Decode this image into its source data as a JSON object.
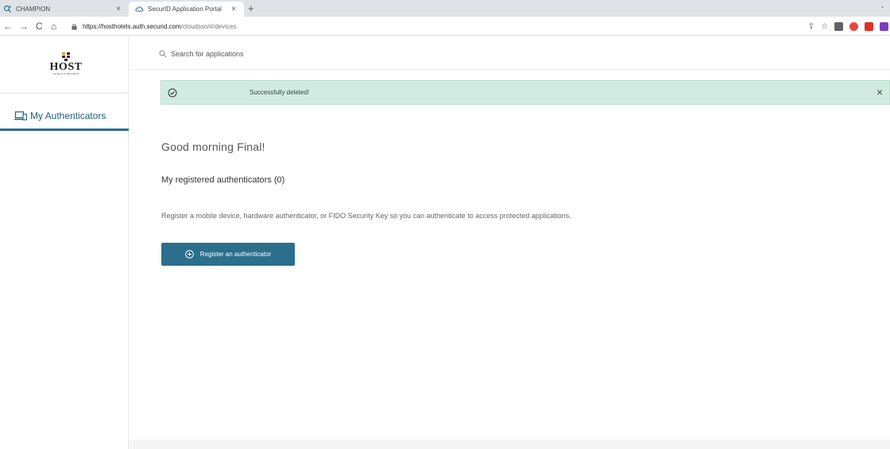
{
  "browser": {
    "tabs": [
      {
        "title": "CHAMPION",
        "close": "×",
        "icon": "search-favicon"
      },
      {
        "title": "SecurID Application Portal",
        "close": "×",
        "icon": "cloud-favicon"
      }
    ],
    "new_tab": "+",
    "url_host": "https://hosthotels.auth.securid.com",
    "url_path": "/cloudsso/#/devices",
    "nav": {
      "back": "←",
      "forward": "→",
      "reload": "C",
      "home": "⌂"
    }
  },
  "sidebar": {
    "logo_text": "HOST",
    "logo_sub": "HOTELS & RESORTS",
    "items": [
      {
        "label": "My Authenticators",
        "icon": "devices-icon"
      }
    ]
  },
  "search": {
    "placeholder": "Search for applications"
  },
  "alert": {
    "message": "Successfully deleted!",
    "close": "×",
    "status_color": "#d2ebe2"
  },
  "main": {
    "greeting": "Good morning Final!",
    "registered_heading": "My registered authenticators (0)",
    "description": "Register a mobile device, hardware authenticator, or FIDO Security Key so you can authenticate to access protected applications.",
    "register_button": "Register an authenticator"
  },
  "colors": {
    "accent": "#2b6f8c",
    "sidebar_active": "#1f5d78"
  }
}
